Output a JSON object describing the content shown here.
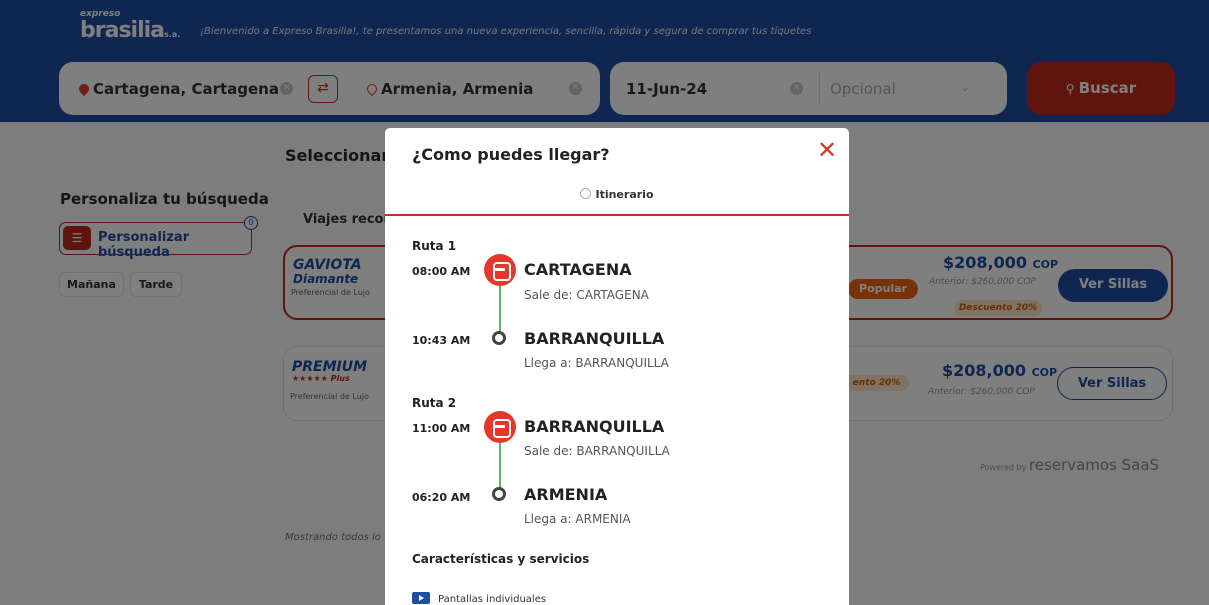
{
  "header": {
    "logo_small": "expreso",
    "logo_big": "brasilia",
    "logo_suffix": "s.a.",
    "welcome": "¡Bienvenido a Expreso Brasilia!, te presentamos una nueva experiencia, sencilla, rápida y segura de comprar tus tiquetes"
  },
  "search": {
    "origin": "Cartagena, Cartagena",
    "destination": "Armenia, Armenia",
    "date": "11-Jun-24",
    "return_placeholder": "Opcional",
    "buscar_label": "Buscar"
  },
  "sidebar": {
    "title": "Personaliza tu búsqueda",
    "personalizar_label": "Personalizar búsqueda",
    "badge_count": "0",
    "chips": [
      "Mañana",
      "Tarde"
    ]
  },
  "results": {
    "heading": "Seleccionar l",
    "tab": "Viajes recon",
    "footer": "Mostrando todos lo",
    "powered_by": "Powered by",
    "powered_brand": "reservamos SaaS",
    "cards": [
      {
        "brand": "GAVIOTA",
        "brand_line2": "Diamante",
        "subtitle": "Preferencial de Lujo",
        "tag": "Popular",
        "price": "$208,000",
        "currency": "COP",
        "anterior": "Anterior: $260,000 COP",
        "descuento": "Descuento 20%",
        "button": "Ver Sillas"
      },
      {
        "brand": "PREMIUM",
        "brand_line2": "★★★★★ Plus",
        "subtitle": "Preferencial de Lujo",
        "tag": "ento 20%",
        "price": "$208,000",
        "currency": "COP",
        "anterior": "Anterior: $260,000 COP",
        "button": "Ver Sillas"
      }
    ]
  },
  "modal": {
    "title": "¿Como puedes llegar?",
    "close_glyph": "✕",
    "tab_label": "Itinerario",
    "routes": [
      {
        "label": "Ruta 1",
        "depart_time": "08:00 AM",
        "depart_city": "CARTAGENA",
        "depart_sub": "Sale de: CARTAGENA",
        "arrive_time": "10:43 AM",
        "arrive_city": "BARRANQUILLA",
        "arrive_sub": "Llega a: BARRANQUILLA"
      },
      {
        "label": "Ruta 2",
        "depart_time": "11:00 AM",
        "depart_city": "BARRANQUILLA",
        "depart_sub": "Sale de: BARRANQUILLA",
        "arrive_time": "06:20 AM",
        "arrive_city": "ARMENIA",
        "arrive_sub": "Llega a: ARMENIA"
      }
    ],
    "features_title": "Características y servicios",
    "features": [
      "Pantallas individuales"
    ]
  },
  "colors": {
    "brand_blue": "#1e4fa0",
    "brand_red": "#c0281d",
    "route_green": "#5cb85c",
    "discount_orange": "#f1640f"
  }
}
